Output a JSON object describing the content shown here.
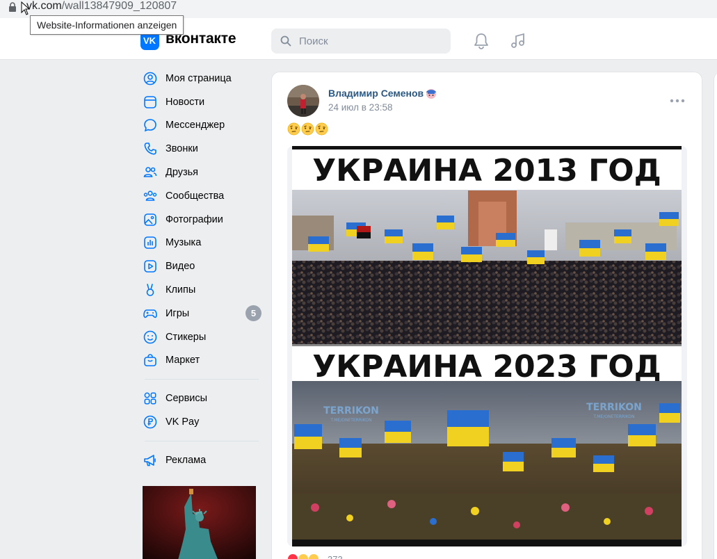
{
  "browser": {
    "url_prefix": "",
    "url_domain": "vk.com",
    "url_path": "/wall13847909_120807",
    "tooltip": "Website-Informationen anzeigen"
  },
  "header": {
    "brand": "вконтакте",
    "logo_text": "VK",
    "search_placeholder": "Поиск",
    "accent": "#0077ff"
  },
  "nav": {
    "items": [
      {
        "label": "Моя страница",
        "icon": "user-circle-icon"
      },
      {
        "label": "Новости",
        "icon": "news-icon"
      },
      {
        "label": "Мессенджер",
        "icon": "message-icon"
      },
      {
        "label": "Звонки",
        "icon": "phone-icon"
      },
      {
        "label": "Друзья",
        "icon": "friends-icon"
      },
      {
        "label": "Сообщества",
        "icon": "communities-icon"
      },
      {
        "label": "Фотографии",
        "icon": "photo-icon"
      },
      {
        "label": "Музыка",
        "icon": "music-icon"
      },
      {
        "label": "Видео",
        "icon": "video-icon"
      },
      {
        "label": "Клипы",
        "icon": "clips-icon"
      },
      {
        "label": "Игры",
        "icon": "gamepad-icon",
        "badge": "5"
      },
      {
        "label": "Стикеры",
        "icon": "smile-icon"
      },
      {
        "label": "Маркет",
        "icon": "bag-icon"
      }
    ],
    "secondary": [
      {
        "label": "Сервисы",
        "icon": "services-icon"
      },
      {
        "label": "VK Pay",
        "icon": "vkpay-icon"
      }
    ],
    "tertiary": [
      {
        "label": "Реклама",
        "icon": "megaphone-icon"
      }
    ]
  },
  "post": {
    "author": "Владимир Семенов",
    "date": "24 июл в 23:58",
    "text_emojis": [
      "🤨",
      "🤨",
      "🤨"
    ],
    "image": {
      "top_caption": "УКРАИНА 2013 ГОД",
      "bottom_caption": "УКРАИНА 2023 ГОД",
      "watermark": "TERRIKON",
      "watermark_sub": "T.ME/ONETERRIKON"
    },
    "reaction_count": "373"
  }
}
